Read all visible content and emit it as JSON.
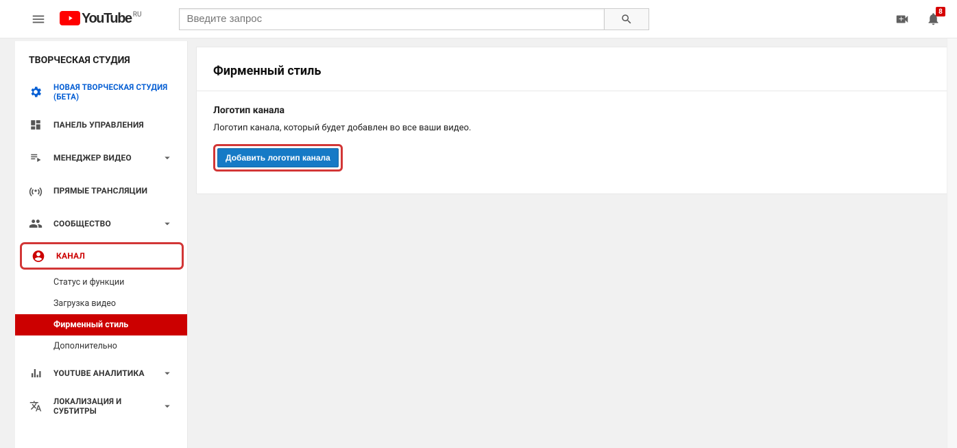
{
  "header": {
    "logo_text": "YouTube",
    "logo_region": "RU",
    "search_placeholder": "Введите запрос",
    "notification_count": "8"
  },
  "sidebar": {
    "title": "ТВОРЧЕСКАЯ СТУДИЯ",
    "beta_label": "НОВАЯ ТВОРЧЕСКАЯ СТУДИЯ (БЕТА)",
    "items": {
      "dashboard": "ПАНЕЛЬ УПРАВЛЕНИЯ",
      "video_manager": "МЕНЕДЖЕР ВИДЕО",
      "live": "ПРЯМЫЕ ТРАНСЛЯЦИИ",
      "community": "СООБЩЕСТВО",
      "channel": "КАНАЛ",
      "analytics": "YOUTUBE АНАЛИТИКА",
      "localization": "ЛОКАЛИЗАЦИЯ И СУБТИТРЫ"
    },
    "channel_sub": {
      "status": "Статус и функции",
      "upload": "Загрузка видео",
      "branding": "Фирменный стиль",
      "advanced": "Дополнительно"
    }
  },
  "main": {
    "page_title": "Фирменный стиль",
    "section_title": "Логотип канала",
    "section_desc": "Логотип канала, который будет добавлен во все ваши видео.",
    "add_logo_button": "Добавить логотип канала"
  }
}
